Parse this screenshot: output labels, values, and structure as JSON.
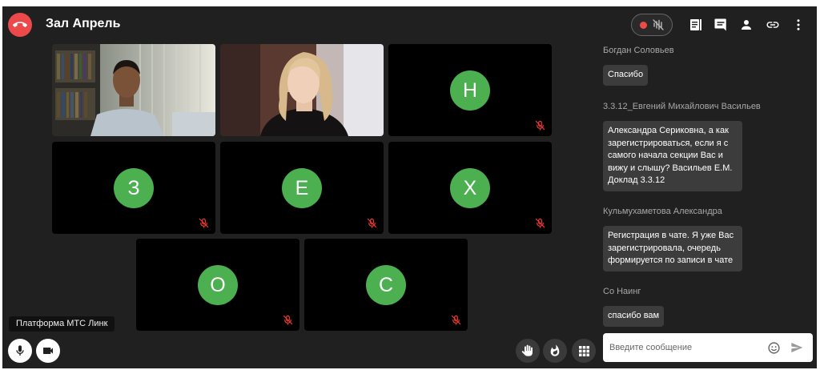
{
  "header": {
    "title": "Зал Апрель"
  },
  "participants": [
    {
      "initial": "Н"
    },
    {
      "initial": "З"
    },
    {
      "initial": "Е"
    },
    {
      "initial": "Х"
    },
    {
      "initial": "О"
    },
    {
      "initial": "С"
    }
  ],
  "footer": {
    "platform_label": "Платформа МТС Линк"
  },
  "chat": {
    "messages": [
      {
        "author": "Богдан Соловьев",
        "text": "Спасибо"
      },
      {
        "author": "3.3.12_Евгений Михайлович Васильев",
        "lines": [
          "Александра Сериковна,  а как",
          "зарегистрироваться, если я с",
          "самого начала секции Вас и",
          "вижу и слышу? Васильев Е.М.",
          "Доклад 3.3.12"
        ]
      },
      {
        "author": "Кульмухаметова Александра",
        "lines": [
          "Регистрация в чате. Я уже Вас",
          "зарегистрировала, очередь",
          "формируется по записи в чате"
        ]
      },
      {
        "author": "Со Наинг",
        "text": "спасибо вам"
      }
    ],
    "input_placeholder": "Введите сообщение"
  },
  "colors": {
    "background": "#202020",
    "hangup": "#ec4a4a",
    "avatar": "#4caf50",
    "record_dot": "#ef4a4a",
    "bubble": "#3c3c3c"
  },
  "icons": [
    "hangup-icon",
    "record-dot-icon",
    "audio-wave-icon",
    "notes-icon",
    "chat-icon",
    "person-icon",
    "link-icon",
    "more-vert-icon",
    "mic-muted-icon",
    "mic-icon",
    "camera-icon",
    "hand-raise-icon",
    "fire-icon",
    "grid-icon",
    "emoji-icon",
    "send-icon"
  ]
}
